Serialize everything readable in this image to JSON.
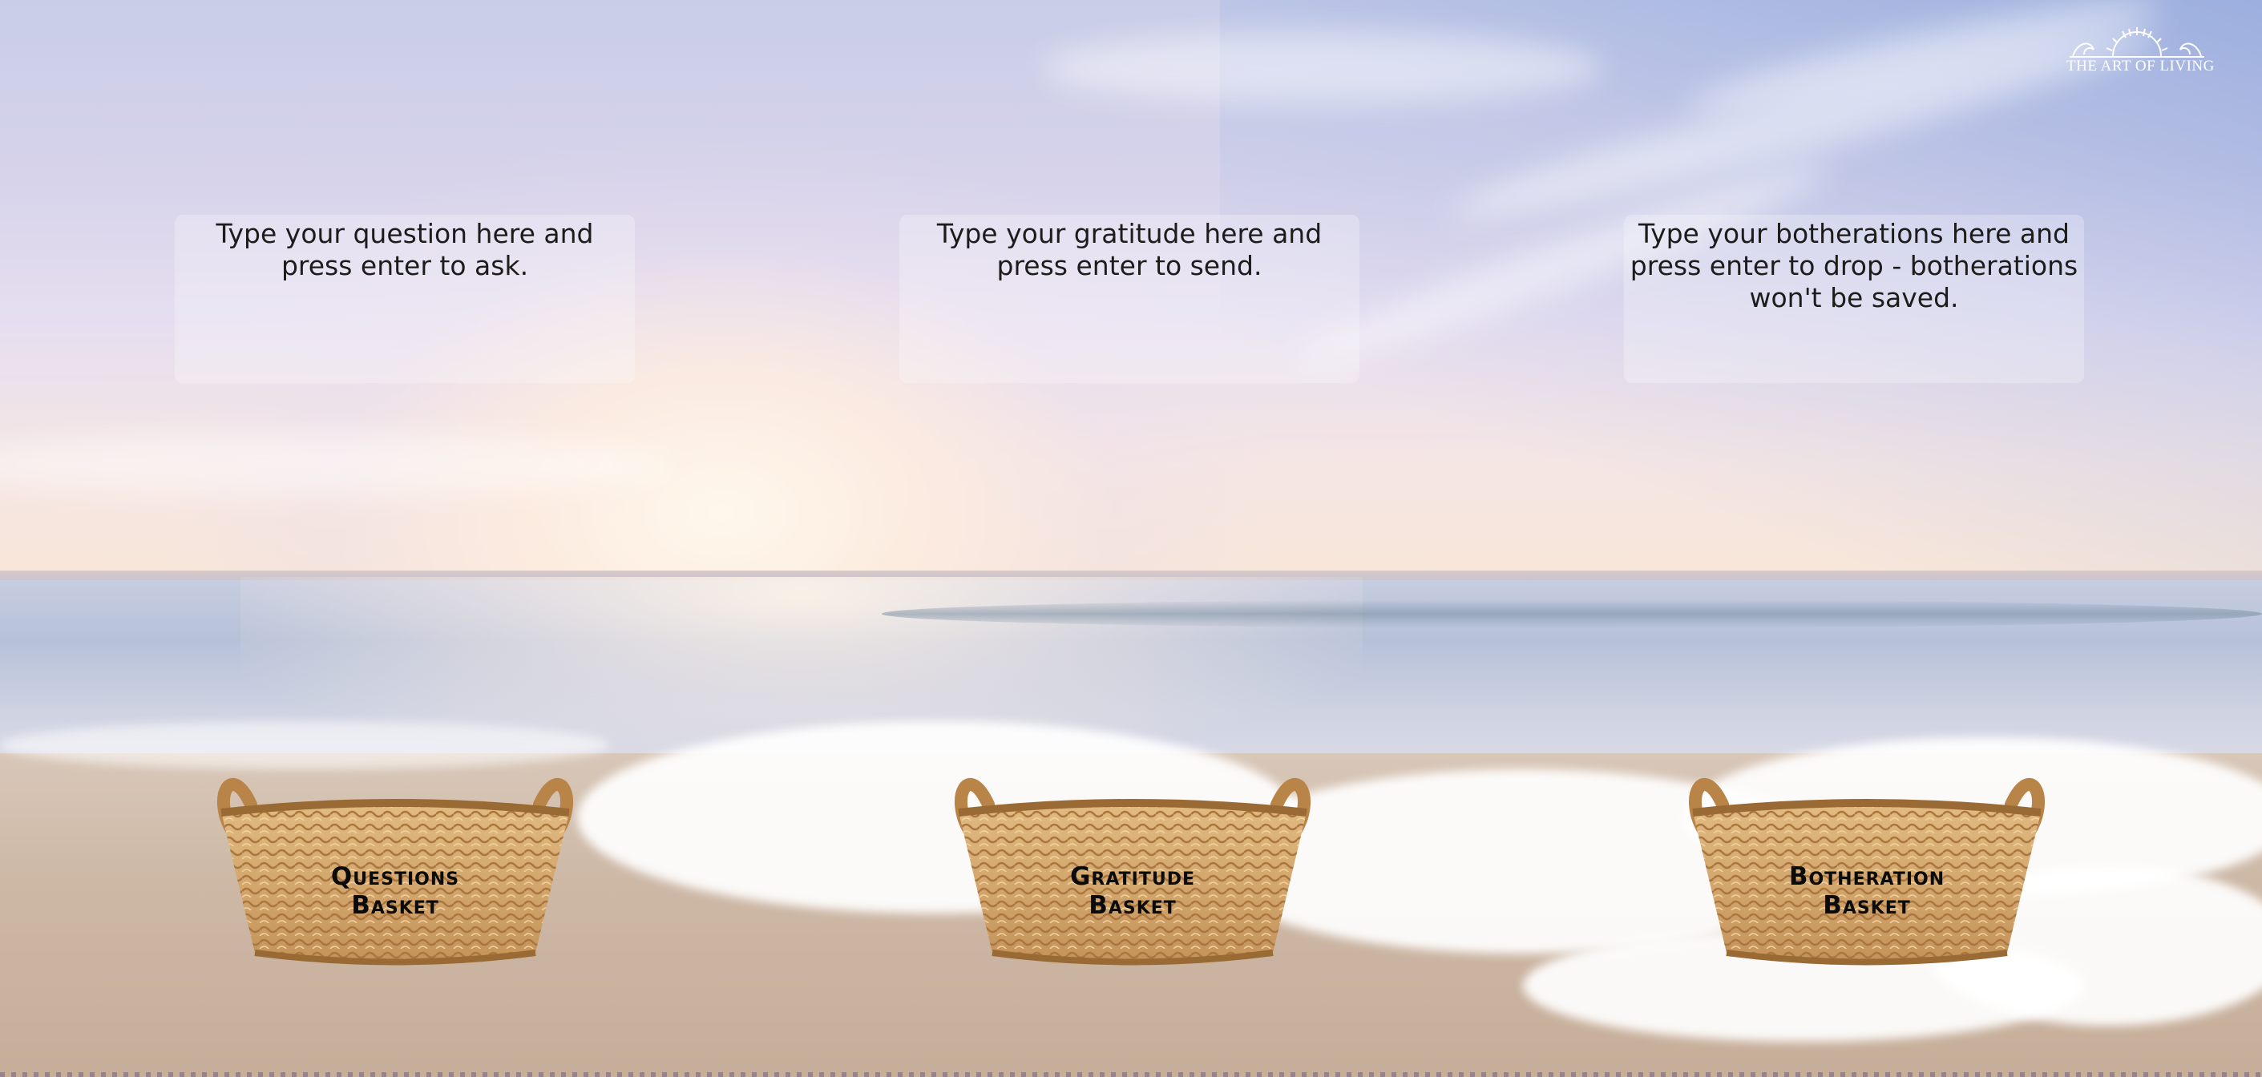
{
  "logo": {
    "text": "THE ART OF LIVING"
  },
  "questions": {
    "placeholder": "Type your question here and press enter to ask.",
    "basket_label": "Questions\nBasket"
  },
  "gratitude": {
    "placeholder": "Type your gratitude here and press enter to send.",
    "basket_label": "Gratitude\nBasket"
  },
  "botheration": {
    "placeholder": "Type your botherations here and press enter to drop - botherations won't be saved.",
    "basket_label": "Botheration\nBasket"
  },
  "colors": {
    "text": "#1c1c1c",
    "input_bg": "rgba(255,255,255,0.26)",
    "basket_wicker": "#d8ad6e"
  }
}
